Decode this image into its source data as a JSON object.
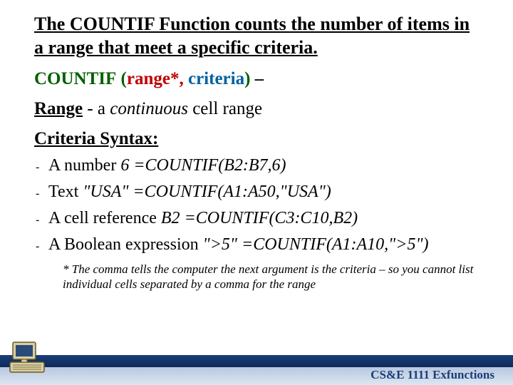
{
  "title": "The COUNTIF Function counts the number of items in a range that meet a specific criteria.",
  "syntax": {
    "fn": "COUNTIF",
    "open": "(",
    "range": "range*",
    "comma": ",",
    "criteria": "criteria",
    "close": ")",
    "tail": " –"
  },
  "range_line": {
    "label": "Range",
    "sep": " - a ",
    "continuous": "continuous",
    "rest": " cell range"
  },
  "criteria_label": "Criteria Syntax:",
  "bullets": [
    {
      "plain": "A number ",
      "example_arg": "6",
      "formula": "   =COUNTIF(B2:B7,6)"
    },
    {
      "plain": "Text ",
      "example_arg": "\"USA\"",
      "formula": "     =COUNTIF(A1:A50,\"USA\")"
    },
    {
      "plain": "A cell reference ",
      "example_arg": "B2",
      "formula": "     =COUNTIF(C3:C10,B2)"
    },
    {
      "plain": "A Boolean expression ",
      "example_arg": "\">5\"",
      "formula": "  =COUNTIF(A1:A10,\">5\")"
    }
  ],
  "footnote": "* The comma tells the computer the next argument is the criteria – so you cannot list individual cells separated by a comma for the range",
  "footer": "CS&E 1111  Exfunctions"
}
